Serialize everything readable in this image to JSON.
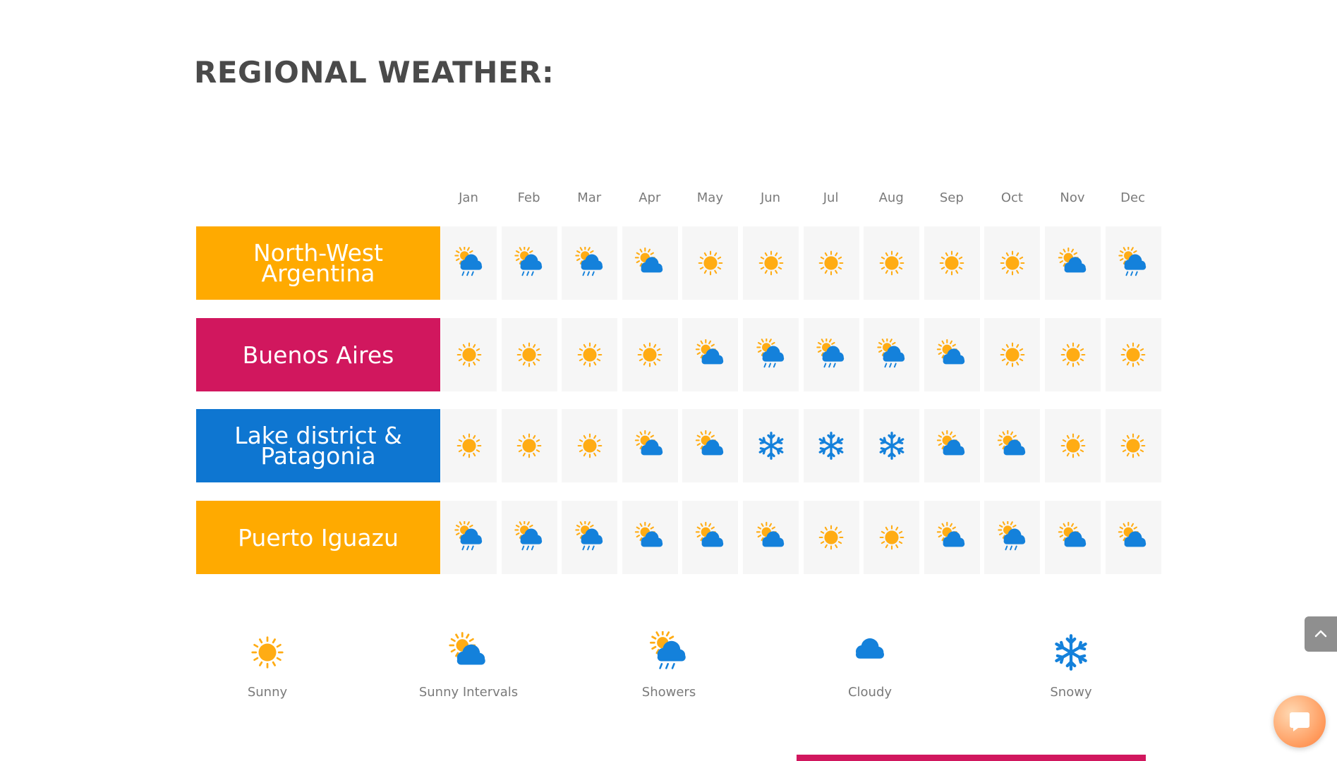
{
  "title": "REGIONAL WEATHER:",
  "months": [
    "Jan",
    "Feb",
    "Mar",
    "Apr",
    "May",
    "Jun",
    "Jul",
    "Aug",
    "Sep",
    "Oct",
    "Nov",
    "Dec"
  ],
  "colors": {
    "orange": "#ffaa00",
    "magenta": "#d1175e",
    "blue": "#0e76d1",
    "sun": "#ffac14",
    "cloud": "#1481db",
    "cell_bg": "#f6f6f6",
    "title": "#4a4a4a"
  },
  "regions": [
    {
      "name": "North-West Argentina",
      "color": "#ffaa00",
      "weather": [
        "showers",
        "showers",
        "showers",
        "sunny-intervals",
        "sunny",
        "sunny",
        "sunny",
        "sunny",
        "sunny",
        "sunny",
        "sunny-intervals",
        "showers"
      ]
    },
    {
      "name": "Buenos Aires",
      "color": "#d1175e",
      "weather": [
        "sunny",
        "sunny",
        "sunny",
        "sunny",
        "sunny-intervals",
        "showers",
        "showers",
        "showers",
        "sunny-intervals",
        "sunny",
        "sunny",
        "sunny"
      ]
    },
    {
      "name": "Lake district & Patagonia",
      "color": "#0e76d1",
      "weather": [
        "sunny",
        "sunny",
        "sunny",
        "sunny-intervals",
        "sunny-intervals",
        "snowy",
        "snowy",
        "snowy",
        "sunny-intervals",
        "sunny-intervals",
        "sunny",
        "sunny"
      ]
    },
    {
      "name": "Puerto Iguazu",
      "color": "#ffaa00",
      "weather": [
        "showers",
        "showers",
        "showers",
        "sunny-intervals",
        "sunny-intervals",
        "sunny-intervals",
        "sunny",
        "sunny",
        "sunny-intervals",
        "showers",
        "sunny-intervals",
        "sunny-intervals"
      ]
    }
  ],
  "legend": [
    {
      "key": "sunny",
      "label": "Sunny",
      "icon": "sun-icon"
    },
    {
      "key": "sunny-intervals",
      "label": "Sunny Intervals",
      "icon": "sun-cloud-icon"
    },
    {
      "key": "showers",
      "label": "Showers",
      "icon": "sun-cloud-rain-icon"
    },
    {
      "key": "cloudy",
      "label": "Cloudy",
      "icon": "cloud-icon"
    },
    {
      "key": "snowy",
      "label": "Snowy",
      "icon": "snowflake-icon"
    }
  ],
  "widgets": {
    "scroll_top_icon": "chevron-up-icon",
    "chat_icon": "chat-bubble-icon"
  }
}
